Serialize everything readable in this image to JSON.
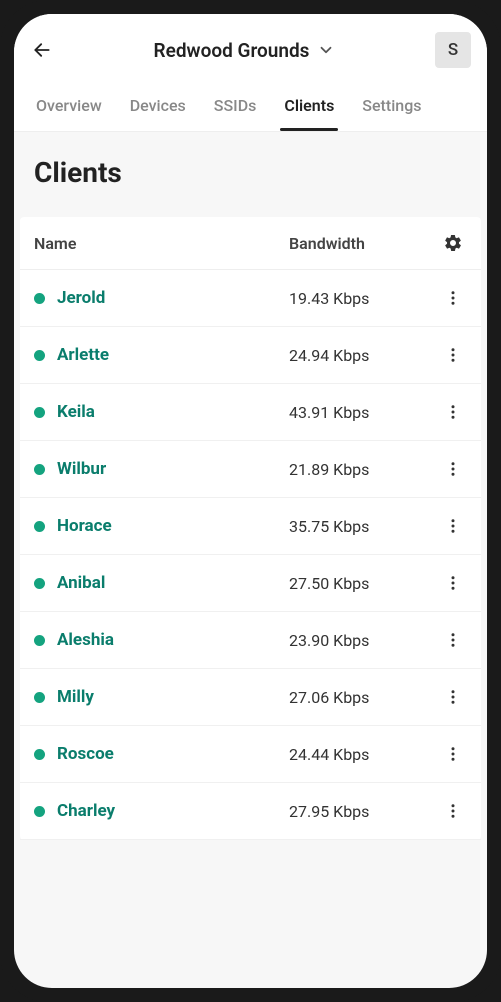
{
  "header": {
    "site_name": "Redwood Grounds",
    "avatar_initial": "S"
  },
  "tabs": [
    {
      "label": "Overview",
      "active": false
    },
    {
      "label": "Devices",
      "active": false
    },
    {
      "label": "SSIDs",
      "active": false
    },
    {
      "label": "Clients",
      "active": true
    },
    {
      "label": "Settings",
      "active": false
    }
  ],
  "page": {
    "title": "Clients"
  },
  "table": {
    "headers": {
      "name": "Name",
      "bandwidth": "Bandwidth"
    },
    "rows": [
      {
        "name": "Jerold",
        "bandwidth": "19.43 Kbps",
        "status": "online"
      },
      {
        "name": "Arlette",
        "bandwidth": "24.94 Kbps",
        "status": "online"
      },
      {
        "name": "Keila",
        "bandwidth": "43.91 Kbps",
        "status": "online"
      },
      {
        "name": "Wilbur",
        "bandwidth": "21.89 Kbps",
        "status": "online"
      },
      {
        "name": "Horace",
        "bandwidth": "35.75 Kbps",
        "status": "online"
      },
      {
        "name": "Anibal",
        "bandwidth": "27.50 Kbps",
        "status": "online"
      },
      {
        "name": "Aleshia",
        "bandwidth": "23.90 Kbps",
        "status": "online"
      },
      {
        "name": "Milly",
        "bandwidth": "27.06 Kbps",
        "status": "online"
      },
      {
        "name": "Roscoe",
        "bandwidth": "24.44 Kbps",
        "status": "online"
      },
      {
        "name": "Charley",
        "bandwidth": "27.95 Kbps",
        "status": "online"
      }
    ]
  },
  "colors": {
    "accent": "#0a7d6c",
    "status_online": "#14a37f"
  }
}
